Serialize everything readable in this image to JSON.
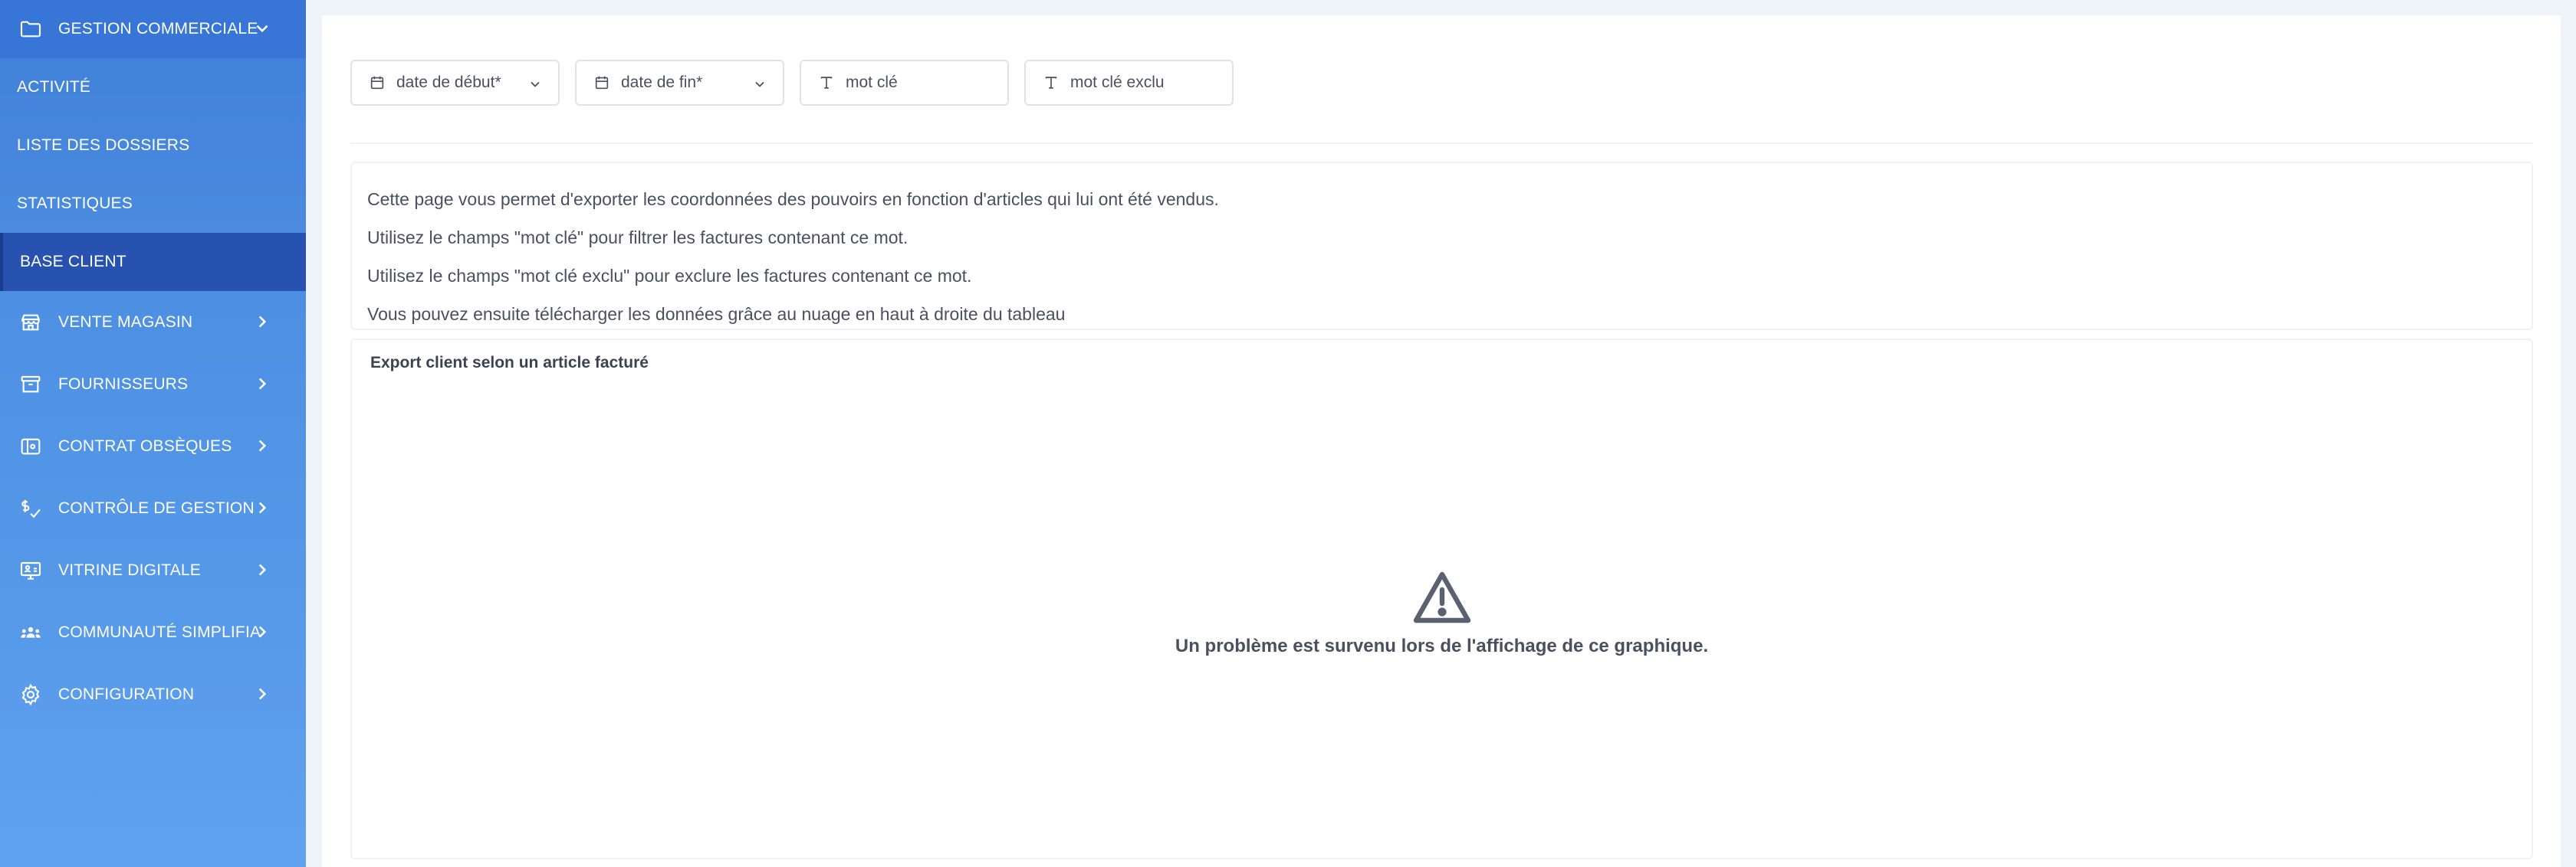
{
  "sidebar": {
    "section": {
      "label": "GESTION COMMERCIALE",
      "icon": "folder-icon"
    },
    "sub_items": [
      {
        "label": "ACTIVITÉ",
        "active": false
      },
      {
        "label": "LISTE DES DOSSIERS",
        "active": false
      },
      {
        "label": "STATISTIQUES",
        "active": false
      },
      {
        "label": "BASE CLIENT",
        "active": true
      }
    ],
    "items": [
      {
        "label": "VENTE MAGASIN",
        "icon": "store-icon"
      },
      {
        "label": "FOURNISSEURS",
        "icon": "archive-icon"
      },
      {
        "label": "CONTRAT OBSÈQUES",
        "icon": "wallet-icon"
      },
      {
        "label": "CONTRÔLE DE GESTION",
        "icon": "dollar-check-icon"
      },
      {
        "label": "VITRINE DIGITALE",
        "icon": "screen-user-icon"
      },
      {
        "label": "COMMUNAUTÉ SIMPLIFIA",
        "icon": "group-icon"
      },
      {
        "label": "CONFIGURATION",
        "icon": "gear-icon"
      }
    ]
  },
  "filters": {
    "start_date": {
      "label": "date de début*",
      "icon": "calendar-icon"
    },
    "end_date": {
      "label": "date de fin*",
      "icon": "calendar-icon"
    },
    "keyword": {
      "label": "mot clé",
      "icon": "text-icon"
    },
    "excluded_keyword": {
      "label": "mot clé exclu",
      "icon": "text-icon"
    }
  },
  "info": {
    "lines": [
      "Cette page vous permet d'exporter les coordonnées des pouvoirs en fonction d'articles qui lui ont été vendus.",
      "Utilisez le champs \"mot clé\" pour filtrer les factures contenant ce mot.",
      "Utilisez le champs \"mot clé exclu\" pour exclure les factures contenant ce mot.",
      "Vous pouvez ensuite télécharger les données grâce au nuage en haut à droite du tableau"
    ]
  },
  "chart": {
    "title": "Export client selon un article facturé",
    "error_message": "Un problème est survenu lors de l'affichage de ce graphique.",
    "error_icon": "warning-icon"
  },
  "colors": {
    "sidebar_top": "#3f7fd8",
    "sidebar_bottom": "#5fa2ef",
    "active_item": "#2752b0",
    "page_bg": "#eef4f8"
  }
}
